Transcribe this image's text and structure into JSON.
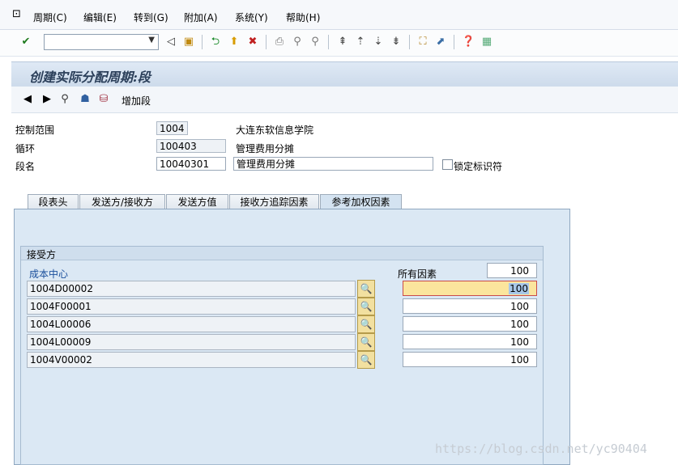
{
  "menu": {
    "items": [
      {
        "label": "周期(C)"
      },
      {
        "label": "编辑(E)"
      },
      {
        "label": "转到(G)"
      },
      {
        "label": "附加(A)"
      },
      {
        "label": "系统(Y)"
      },
      {
        "label": "帮助(H)"
      }
    ]
  },
  "toolbar": {
    "command_value": ""
  },
  "title": "创建实际分配周期:段",
  "app_toolbar": {
    "add_segment_label": "增加段"
  },
  "form": {
    "controlling_area": {
      "label": "控制范围",
      "value": "1004",
      "desc": "大连东软信息学院"
    },
    "cycle": {
      "label": "循环",
      "value": "100403",
      "desc": "管理费用分摊"
    },
    "segment": {
      "label": "段名",
      "value": "10040301",
      "desc": "管理费用分摊"
    },
    "lock_label": "锁定标识符"
  },
  "tabs": [
    {
      "label": "段表头"
    },
    {
      "label": "发送方/接收方"
    },
    {
      "label": "发送方值"
    },
    {
      "label": "接收方追踪因素"
    },
    {
      "label": "参考加权因素",
      "active": true
    }
  ],
  "receivers": {
    "group_title": "接受方",
    "col_header": "成本中心",
    "all_factors_label": "所有因素",
    "all_factors_value": "100",
    "rows": [
      {
        "cost_center": "1004D00002",
        "factor": "100"
      },
      {
        "cost_center": "1004F00001",
        "factor": "100"
      },
      {
        "cost_center": "1004L00006",
        "factor": "100"
      },
      {
        "cost_center": "1004L00009",
        "factor": "100"
      },
      {
        "cost_center": "1004V00002",
        "factor": "100"
      }
    ]
  },
  "watermark": "https://blog.csdn.net/yc90404"
}
